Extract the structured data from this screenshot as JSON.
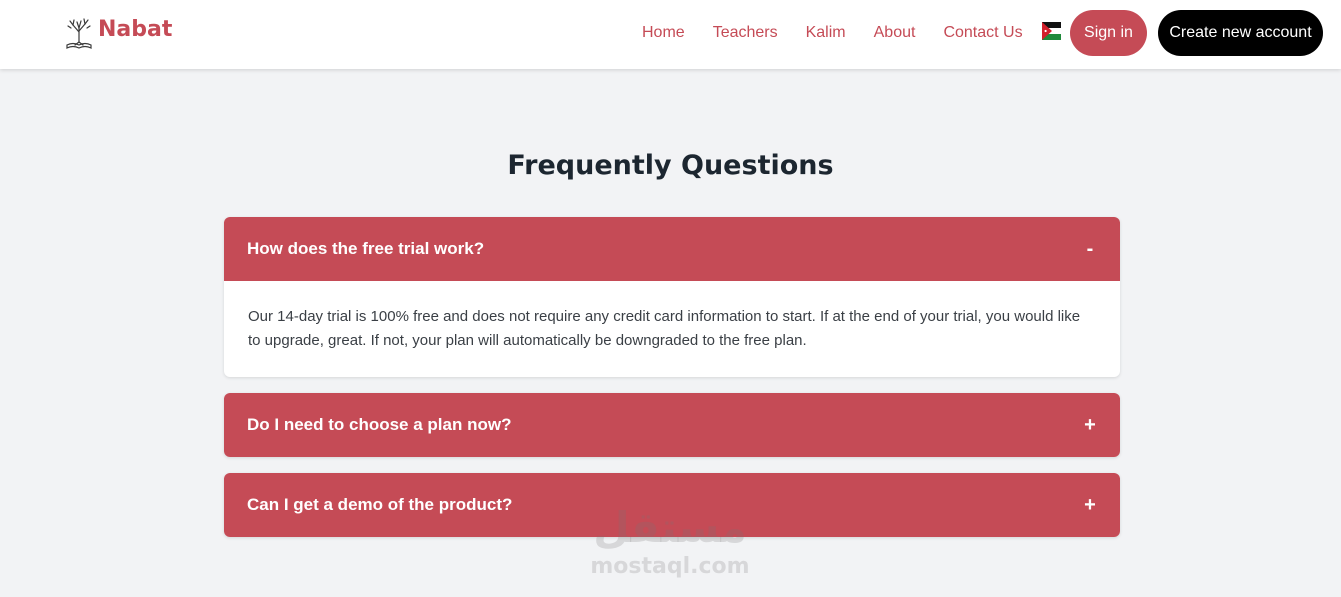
{
  "header": {
    "brand": "Nabat",
    "nav": [
      {
        "label": "Home"
      },
      {
        "label": "Teachers"
      },
      {
        "label": "Kalim"
      },
      {
        "label": "About"
      },
      {
        "label": "Contact Us"
      }
    ],
    "language_flag": "jordan-flag-icon",
    "signin_label": "Sign in",
    "create_account_label": "Create new account"
  },
  "faq": {
    "title": "Frequently Questions",
    "items": [
      {
        "question": "How does the free trial work?",
        "toggle": "-",
        "expanded": true,
        "answer": "Our 14-day trial is 100% free and does not require any credit card information to start. If at the end of your trial, you would like to upgrade, great. If not, your plan will automatically be downgraded to the free plan."
      },
      {
        "question": "Do I need to choose a plan now?",
        "toggle": "+",
        "expanded": false
      },
      {
        "question": "Can I get a demo of the product?",
        "toggle": "+",
        "expanded": false
      }
    ]
  },
  "watermark": {
    "logo_text": "مستقل",
    "url": "mostaql.com"
  },
  "colors": {
    "brand": "#c54b56",
    "background": "#f2f3f5",
    "title": "#1c2630",
    "dark_button": "#000000"
  }
}
